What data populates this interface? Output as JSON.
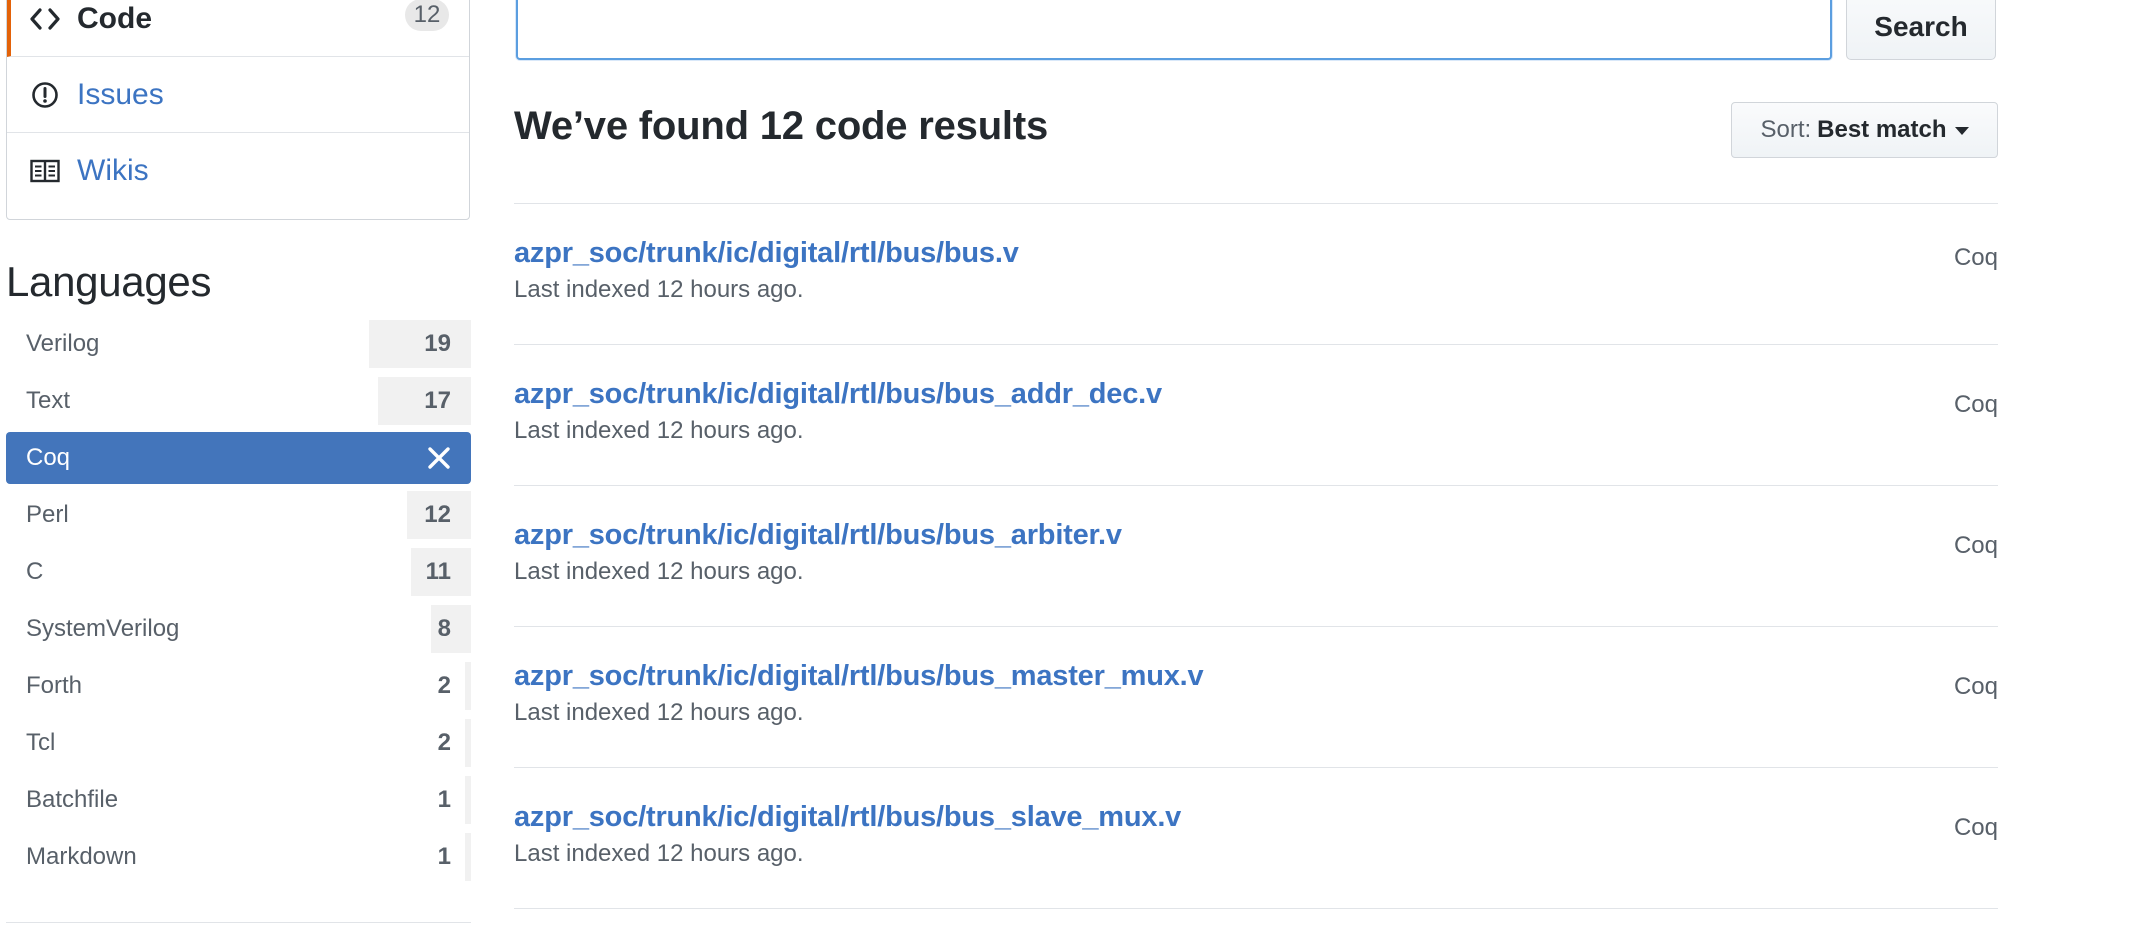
{
  "nav": {
    "items": [
      {
        "label": "Code",
        "count": "12",
        "icon": "code-icon",
        "selected": true
      },
      {
        "label": "Issues",
        "icon": "issue-opened-icon",
        "selected": false
      },
      {
        "label": "Wikis",
        "icon": "book-icon",
        "selected": false
      }
    ]
  },
  "languages": {
    "heading": "Languages",
    "items": [
      {
        "name": "Verilog",
        "count": "19"
      },
      {
        "name": "Text",
        "count": "17"
      },
      {
        "name": "Coq",
        "selected": true
      },
      {
        "name": "Perl",
        "count": "12"
      },
      {
        "name": "C",
        "count": "11"
      },
      {
        "name": "SystemVerilog",
        "count": "8"
      },
      {
        "name": "Forth",
        "count": "2"
      },
      {
        "name": "Tcl",
        "count": "2"
      },
      {
        "name": "Batchfile",
        "count": "1"
      },
      {
        "name": "Markdown",
        "count": "1"
      }
    ]
  },
  "search": {
    "value": "",
    "button_label": "Search"
  },
  "results": {
    "title": "We’ve found 12 code results",
    "sort_prefix": "Sort:",
    "sort_value": "Best match",
    "items": [
      {
        "path": "azpr_soc/trunk/ic/digital/rtl/bus/bus.v",
        "meta": "Last indexed 12 hours ago.",
        "language": "Coq"
      },
      {
        "path": "azpr_soc/trunk/ic/digital/rtl/bus/bus_addr_dec.v",
        "meta": "Last indexed 12 hours ago.",
        "language": "Coq"
      },
      {
        "path": "azpr_soc/trunk/ic/digital/rtl/bus/bus_arbiter.v",
        "meta": "Last indexed 12 hours ago.",
        "language": "Coq"
      },
      {
        "path": "azpr_soc/trunk/ic/digital/rtl/bus/bus_master_mux.v",
        "meta": "Last indexed 12 hours ago.",
        "language": "Coq"
      },
      {
        "path": "azpr_soc/trunk/ic/digital/rtl/bus/bus_slave_mux.v",
        "meta": "Last indexed 12 hours ago.",
        "language": "Coq"
      }
    ]
  },
  "colors": {
    "link": "#3c74c2",
    "selected_language_bg": "#4375bb",
    "nav_selected_accent": "#e36209",
    "search_focus_border": "#5b9ee0"
  }
}
